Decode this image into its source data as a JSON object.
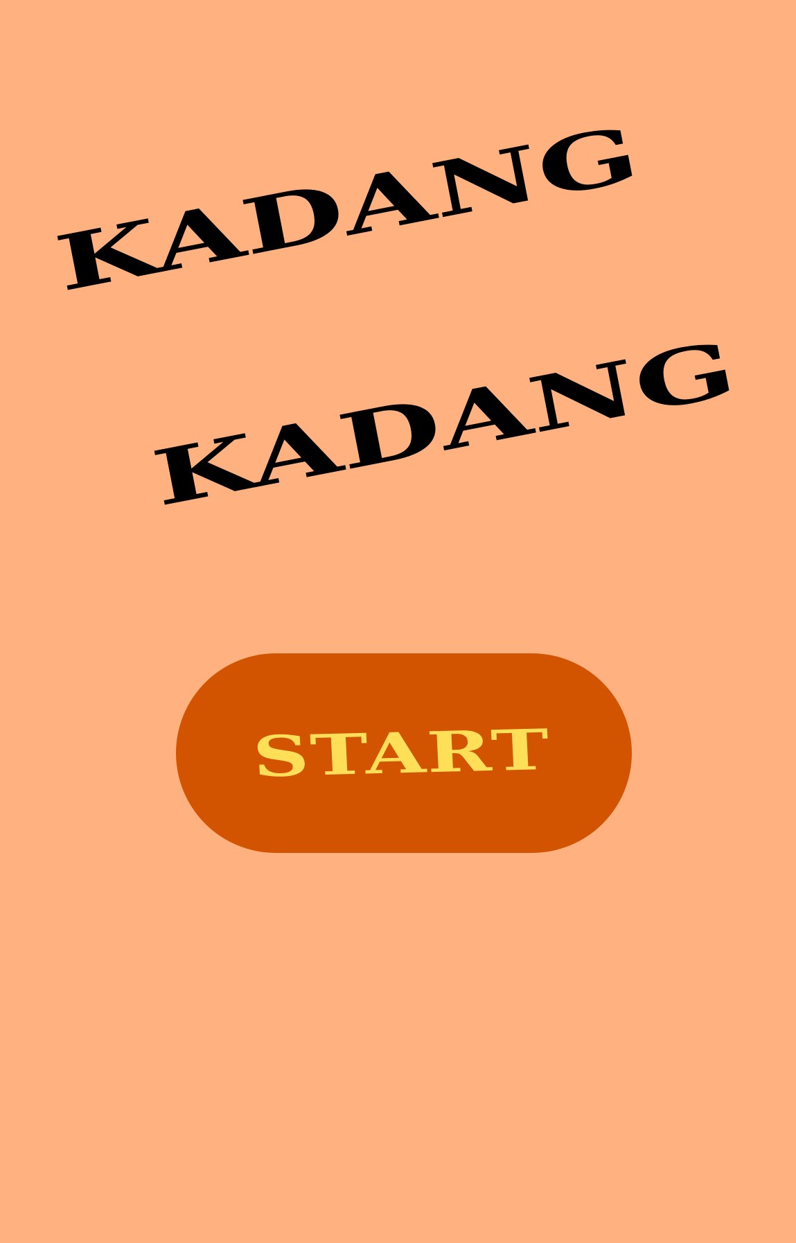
{
  "game": {
    "title_line_1": "KADANG",
    "title_line_2": "KADANG"
  },
  "start_button": {
    "label": "START"
  },
  "colors": {
    "background": "#FFB17F",
    "title_text": "#000000",
    "button_fill": "#D35400",
    "button_text": "#FFDF58"
  }
}
